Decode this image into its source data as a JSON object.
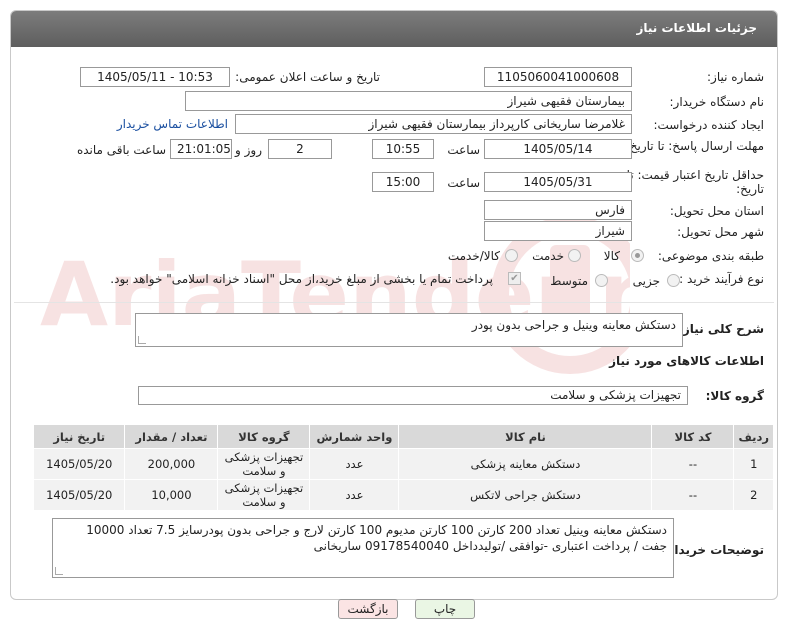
{
  "header": {
    "title": "جزئیات اطلاعات نیاز"
  },
  "labels": {
    "need_number": "شماره نیاز:",
    "announce_datetime": "تاریخ و ساعت اعلان عمومی:",
    "buyer_org": "نام دستگاه خریدار:",
    "requester": "ایجاد کننده درخواست:",
    "contact_link": "اطلاعات تماس خریدار",
    "reply_deadline": "مهلت ارسال پاسخ: تا تاریخ:",
    "time": "ساعت",
    "day_and": "روز و",
    "remaining": "ساعت باقی مانده",
    "price_deadline": "حداقل تاریخ اعتبار قیمت: تا تاریخ:",
    "province": "استان محل تحویل:",
    "city": "شهر محل تحویل:",
    "subject_class": "طبقه بندی موضوعی:",
    "purchase_type": "نوع فرآیند خرید :",
    "description": "شرح کلی نیاز:",
    "goods_info": "اطلاعات کالاهای مورد نیاز",
    "goods_group": "گروه کالا:",
    "buyer_notes": "توضیحات خریدار:"
  },
  "values": {
    "need_number": "1105060041000608",
    "announce_datetime": "1405/05/11 - 10:53",
    "buyer_org": "بیمارستان فقیهی شیراز",
    "requester": "غلامرضا ساریخانی کارپرداز بیمارستان فقیهی شیراز",
    "reply_date": "1405/05/14",
    "reply_time": "10:55",
    "days": "2",
    "remaining_time": "21:01:05",
    "price_date": "1405/05/31",
    "price_time": "15:00",
    "province": "فارس",
    "city": "شیراز",
    "description": "دستکش معاینه وینیل و جراحی بدون پودر",
    "goods_group": "تجهیزات پزشکی و سلامت",
    "buyer_notes": "دستکش معاینه وینیل تعداد 200 کارتن 100 کارتن مدیوم 100 کارتن لارج و جراحی بدون پودرسایز 7.5 تعداد 10000 جفت / پرداخت اعتباری -توافقی /تولیدداخل 09178540040 ساریخانی"
  },
  "subject_options": [
    {
      "label": "کالا",
      "selected": true
    },
    {
      "label": "خدمت",
      "selected": false
    },
    {
      "label": "کالا/خدمت",
      "selected": false
    }
  ],
  "purchase_options": [
    {
      "label": "جزیی",
      "selected": false
    },
    {
      "label": "متوسط",
      "selected": false
    }
  ],
  "payment_note": "پرداخت تمام یا بخشی از مبلغ خرید،از محل \"اسناد خزانه اسلامی\" خواهد بود.",
  "table": {
    "headers": [
      "ردیف",
      "کد کالا",
      "نام کالا",
      "واحد شمارش",
      "گروه کالا",
      "تعداد / مقدار",
      "تاریخ نیاز"
    ],
    "rows": [
      [
        "1",
        "--",
        "دستکش معاینه پزشکی",
        "عدد",
        "تجهیزات پزشکی و سلامت",
        "200,000",
        "1405/05/20"
      ],
      [
        "2",
        "--",
        "دستکش جراحی لاتکس",
        "عدد",
        "تجهیزات پزشکی و سلامت",
        "10,000",
        "1405/05/20"
      ]
    ]
  },
  "buttons": {
    "print": "چاپ",
    "back": "بازگشت"
  },
  "watermark": {
    "text": "AriaTender.net"
  },
  "colors": {
    "header_bg": "#666666",
    "table_head": "#d9d9d9",
    "print_btn": "#eaf6e4",
    "back_btn": "#fbe4e4",
    "link": "#1a4fa0"
  }
}
